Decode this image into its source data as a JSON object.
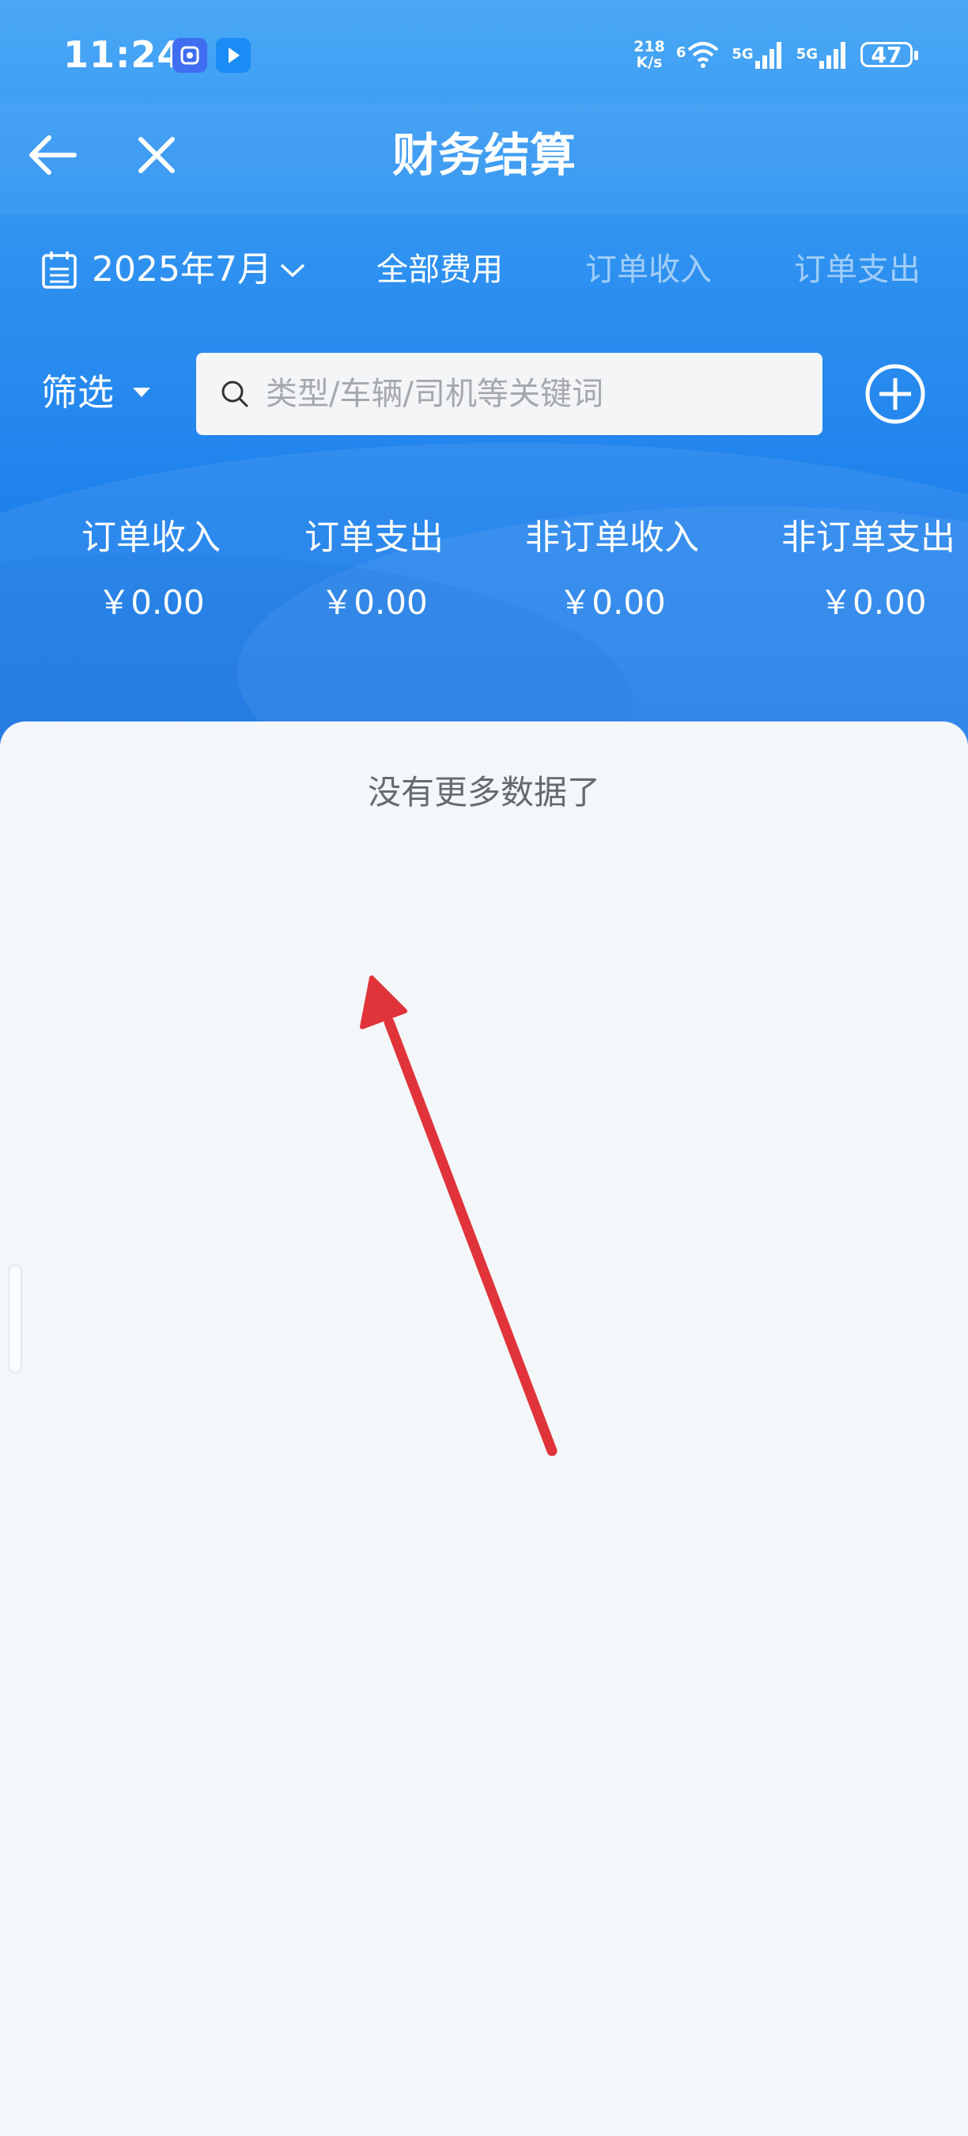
{
  "status_bar": {
    "time": "11:24",
    "net_speed_value": "218",
    "net_speed_unit": "K/s",
    "wifi_label": "6",
    "sig1_label": "5G",
    "sig2_label": "5G",
    "battery": "47"
  },
  "nav": {
    "title": "财务结算"
  },
  "tabs": {
    "month": "2025年7月",
    "items": [
      "全部费用",
      "订单收入",
      "订单支出"
    ]
  },
  "filter": {
    "label": "筛选",
    "search_placeholder": "类型/车辆/司机等关键词"
  },
  "summary": [
    {
      "label": "订单收入",
      "value": "￥0.00"
    },
    {
      "label": "订单支出",
      "value": "￥0.00"
    },
    {
      "label": "非订单收入",
      "value": "￥0.00"
    },
    {
      "label": "非订单支出",
      "value": "￥0.00"
    }
  ],
  "list": {
    "end_text": "没有更多数据了"
  },
  "colors": {
    "header_blue": "#2e91f0",
    "arrow_red": "#e0343a",
    "page_bg": "#f4f7f9"
  }
}
